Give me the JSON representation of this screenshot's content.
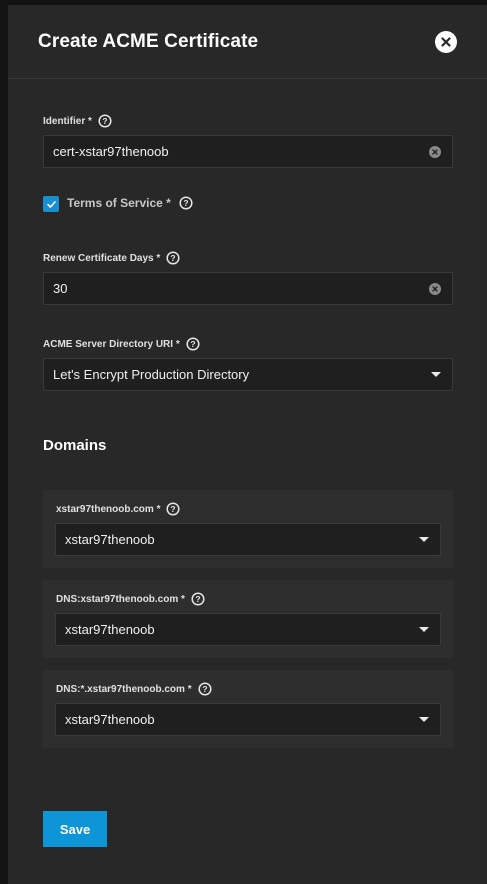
{
  "dialog": {
    "title": "Create ACME Certificate"
  },
  "identifier": {
    "label": "Identifier *",
    "value": "cert-xstar97thenoob"
  },
  "terms": {
    "label": "Terms of Service *",
    "checked": true
  },
  "renew": {
    "label": "Renew Certificate Days *",
    "value": "30"
  },
  "acme_server": {
    "label": "ACME Server Directory URI *",
    "selected": "Let's Encrypt Production Directory"
  },
  "domains": {
    "title": "Domains",
    "items": [
      {
        "label": "xstar97thenoob.com *",
        "selected": "xstar97thenoob"
      },
      {
        "label": "DNS:xstar97thenoob.com *",
        "selected": "xstar97thenoob"
      },
      {
        "label": "DNS:*.xstar97thenoob.com *",
        "selected": "xstar97thenoob"
      }
    ]
  },
  "actions": {
    "save_label": "Save"
  },
  "colors": {
    "accent": "#0d95d8",
    "checkbox": "#1a8fd0",
    "panel_bg": "#282828",
    "input_bg": "#1f1f1f"
  },
  "icons": {
    "close": "close-icon",
    "help": "help-circle-icon",
    "clear": "clear-icon",
    "dropdown": "chevron-down-icon",
    "check": "check-icon"
  }
}
